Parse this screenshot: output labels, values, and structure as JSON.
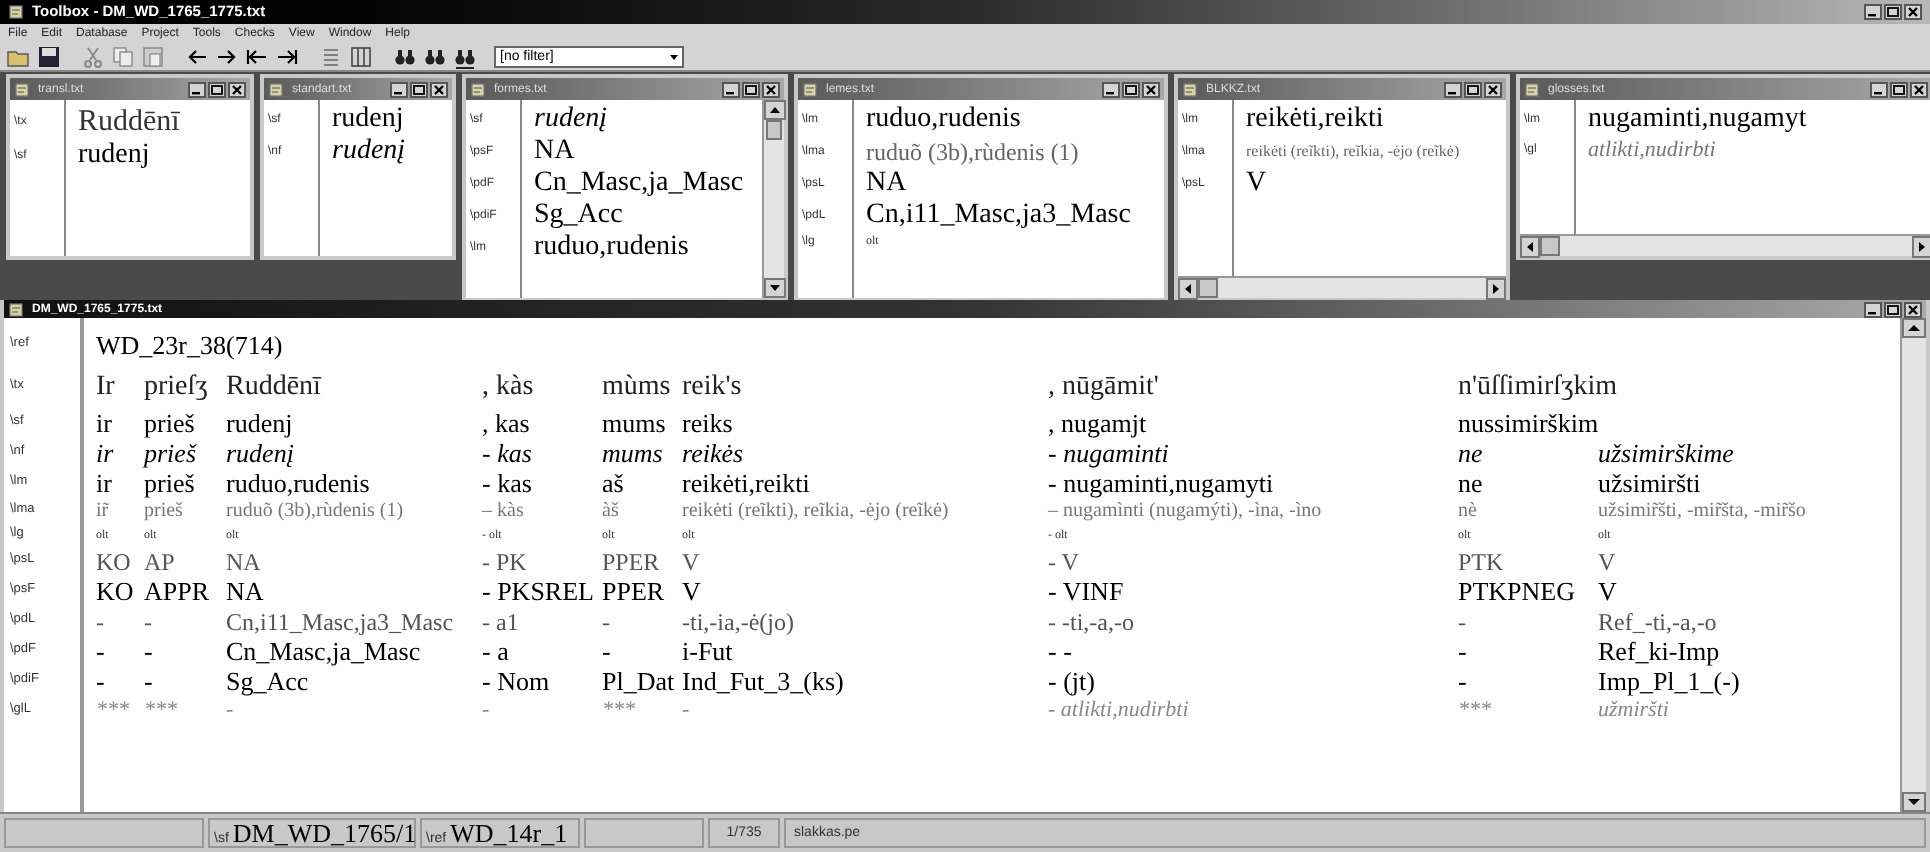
{
  "window": {
    "title": "Toolbox - DM_WD_1765_1775.txt"
  },
  "menu": [
    "File",
    "Edit",
    "Database",
    "Project",
    "Tools",
    "Checks",
    "View",
    "Window",
    "Help"
  ],
  "filter": {
    "value": "[no filter]"
  },
  "child_windows": [
    {
      "title": "transl.txt",
      "rows": [
        {
          "marker": "\\tx",
          "text": "Ruddēnī",
          "kind": "large"
        },
        {
          "marker": "\\sf",
          "text": "rudenj",
          "kind": "regular"
        }
      ]
    },
    {
      "title": "standart.txt",
      "rows": [
        {
          "marker": "\\sf",
          "text": "rudenj",
          "kind": "regular"
        },
        {
          "marker": "\\nf",
          "text": "rudenį",
          "kind": "italic"
        }
      ]
    },
    {
      "title": "formes.txt",
      "rows": [
        {
          "marker": "\\sf",
          "text": "rudenį",
          "kind": "italic"
        },
        {
          "marker": "\\psF",
          "text": "NA",
          "kind": "regular"
        },
        {
          "marker": "\\pdF",
          "text": "Cn_Masc,ja_Masc",
          "kind": "regular"
        },
        {
          "marker": "\\pdiF",
          "text": "Sg_Acc",
          "kind": "regular"
        },
        {
          "marker": "\\lm",
          "text": "ruduo,rudenis",
          "kind": "regular"
        }
      ]
    },
    {
      "title": "lemes.txt",
      "rows": [
        {
          "marker": "\\lm",
          "text": "ruduo,rudenis",
          "kind": "regular"
        },
        {
          "marker": "\\lma",
          "text": "ruduõ (3b),rùdenis (1)",
          "kind": "muted"
        },
        {
          "marker": "\\psL",
          "text": "NA",
          "kind": "regular"
        },
        {
          "marker": "\\pdL",
          "text": "Cn,i11_Masc,ja3_Masc",
          "kind": "regular"
        },
        {
          "marker": "\\lg",
          "text": "olt",
          "kind": "tiny"
        }
      ]
    },
    {
      "title": "BLKKZ.txt",
      "rows": [
        {
          "marker": "\\lm",
          "text": "reikėti,reikti",
          "kind": "regular"
        },
        {
          "marker": "\\lma",
          "text": "reikėti (reĩkti), reĩkia, -ėjo (reĩkė)",
          "kind": "compact"
        },
        {
          "marker": "\\psL",
          "text": "V",
          "kind": "regular"
        }
      ]
    },
    {
      "title": "glosses.txt",
      "rows": [
        {
          "marker": "\\lm",
          "text": "nugaminti,nugamyt",
          "kind": "regular"
        },
        {
          "marker": "\\gl",
          "text": "atlikti,nudirbti",
          "kind": "muted-italic"
        }
      ]
    }
  ],
  "main_window": {
    "title": "DM_WD_1765_1775.txt",
    "rows": [
      {
        "marker": "\\ref",
        "kind": "regular",
        "cells": [
          "WD_23r_38(714)",
          null,
          null,
          null,
          null,
          null,
          null,
          null,
          null
        ]
      },
      {
        "marker": "\\tx",
        "kind": "large",
        "cells": [
          "Ir",
          "prieſʒ",
          "Ruddēnī",
          ", kàs",
          "mùms",
          "reik's",
          ", nūgāmit'",
          "n'ūſſimirſʒkim",
          null
        ]
      },
      {
        "marker": "\\sf",
        "kind": "regular",
        "cells": [
          "ir",
          "prieš",
          "rudenj",
          ", kas",
          "mums",
          "reiks",
          ", nugamjt",
          "nussimirškim",
          null
        ]
      },
      {
        "marker": "\\nf",
        "kind": "italic",
        "cells": [
          "ir",
          "prieš",
          "rudenį",
          "- kas",
          "mums",
          "reikės",
          "- nugaminti",
          "ne",
          "užsimirškime"
        ]
      },
      {
        "marker": "\\lm",
        "kind": "regular",
        "cells": [
          "ir",
          "prieš",
          "ruduo,rudenis",
          "- kas",
          "aš",
          "reikėti,reikti",
          "- nugaminti,nugamyti",
          "ne",
          "užsimiršti"
        ]
      },
      {
        "marker": "\\lma",
        "kind": "small-muted",
        "cells": [
          "ir̃",
          "prieš",
          "ruduõ (3b),rùdenis (1)",
          "– kàs",
          "àš",
          "reikėti (reĩkti), reĩkia, -ėjo (reĩkė)",
          "– nugamìnti (nugamýti), -ìna, -ìno",
          "nè",
          "užsimir̃šti, -mir̃šta, -mir̃šo"
        ]
      },
      {
        "marker": "\\lg",
        "kind": "tiny",
        "cells": [
          "olt",
          "olt",
          "olt",
          "- olt",
          "olt",
          "olt",
          "- olt",
          "olt",
          "olt"
        ]
      },
      {
        "marker": "\\psL",
        "kind": "muted",
        "cells": [
          "KO",
          "AP",
          "NA",
          "- PK",
          "PPER",
          "V",
          "- V",
          "PTK",
          "V"
        ]
      },
      {
        "marker": "\\psF",
        "kind": "regular",
        "cells": [
          "KO",
          "APPR",
          "NA",
          "- PKSREL",
          "PPER",
          "V",
          "- VINF",
          "PTKPNEG",
          "V"
        ]
      },
      {
        "marker": "\\pdL",
        "kind": "muted",
        "cells": [
          "-",
          "-",
          "Cn,i11_Masc,ja3_Masc",
          "- a1",
          "-",
          "-ti,-ia,-ė(jo)",
          "- -ti,-a,-o",
          "-",
          "Ref_-ti,-a,-o"
        ]
      },
      {
        "marker": "\\pdF",
        "kind": "regular",
        "cells": [
          "-",
          "-",
          "Cn_Masc,ja_Masc",
          "- a",
          "-",
          "i-Fut",
          "- -",
          "-",
          "Ref_ki-Imp"
        ]
      },
      {
        "marker": "\\pdiF",
        "kind": "regular",
        "cells": [
          "-",
          "-",
          "Sg_Acc",
          "- Nom",
          "Pl_Dat",
          "Ind_Fut_3_(ks)",
          "- (jt)",
          "-",
          "Imp_Pl_1_(-)"
        ]
      },
      {
        "marker": "\\glL",
        "kind": "muted-italic",
        "cells": [
          "***",
          "***",
          "-",
          "-",
          "***",
          "-",
          "- atlikti,nudirbti",
          "***",
          "užmiršti"
        ]
      }
    ]
  },
  "status_bar": {
    "record": {
      "marker": "\\sf",
      "text": "DM_WD_1765/1"
    },
    "reference": {
      "marker": "\\ref",
      "text": "WD_14r_1"
    },
    "position": "1/735",
    "file": "slakkas.pe"
  }
}
